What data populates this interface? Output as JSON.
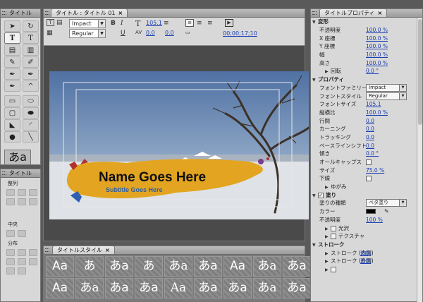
{
  "tools_panel": {
    "title": "タイトル"
  },
  "align_panel": {
    "title": "タイトル",
    "sections": [
      "整列",
      "中央",
      "分布"
    ]
  },
  "editor": {
    "tab_label": "タイトル : タイトル 01",
    "font_family": "Impact",
    "font_style": "Regular",
    "font_size": "105.1",
    "kerning": "0.0",
    "leading": "0.0",
    "timecode": "00;00;17;10",
    "canvas": {
      "title_text": "Name Goes Here",
      "subtitle_text": "Subtitle Goes Here"
    }
  },
  "styles_panel": {
    "title": "タイトルスタイル",
    "swatches": [
      "Aa",
      "あ",
      "あa",
      "あ",
      "あa",
      "あa",
      "Aa",
      "あa",
      "あa",
      "Aa",
      "あa",
      "あa",
      "あa",
      "Aa",
      "あa",
      "あa",
      "あa",
      "あa"
    ]
  },
  "properties": {
    "title": "タイトルプロパティ",
    "rows": [
      {
        "kind": "sec",
        "label": "変形",
        "open": true
      },
      {
        "label": "不透明度",
        "value": "100.0 %"
      },
      {
        "label": "X 座標",
        "value": "100.0 %"
      },
      {
        "label": "Y 座標",
        "value": "100.0 %"
      },
      {
        "label": "幅",
        "value": "100.0 %"
      },
      {
        "label": "高さ",
        "value": "100.0 %"
      },
      {
        "kind": "sub",
        "label": "回転",
        "value": "0.0 °",
        "tri": true
      },
      {
        "kind": "sec",
        "label": "プロパティ",
        "open": true
      },
      {
        "label": "フォントファミリー",
        "drop": "Impact"
      },
      {
        "label": "フォントスタイル",
        "drop": "Regular"
      },
      {
        "label": "フォントサイズ",
        "value": "105.1"
      },
      {
        "label": "縦横比",
        "value": "100.0 %"
      },
      {
        "label": "行間",
        "value": "0.0"
      },
      {
        "label": "カーニング",
        "value": "0.0"
      },
      {
        "label": "トラッキング",
        "value": "0.0"
      },
      {
        "label": "ベースラインシフト",
        "value": "0.0"
      },
      {
        "label": "傾き",
        "value": "0.0 °"
      },
      {
        "label": "オールキャップス",
        "check": true
      },
      {
        "label": "サイズ",
        "value": "75.0 %"
      },
      {
        "label": "下線",
        "check": true
      },
      {
        "kind": "sub",
        "label": "ゆがみ",
        "tri": true
      },
      {
        "kind": "sec",
        "label": "塗り",
        "open": true,
        "checked": true
      },
      {
        "label": "塗りの種類",
        "drop": "ベタ塗り"
      },
      {
        "label": "カラー",
        "color": "#000000"
      },
      {
        "label": "不透明度",
        "value": "100 %"
      },
      {
        "kind": "sub",
        "label": "光沢",
        "tri": true,
        "check": true
      },
      {
        "kind": "sub",
        "label": "テクスチャ",
        "tri": true,
        "check": true
      },
      {
        "kind": "sec",
        "label": "ストローク",
        "open": true
      },
      {
        "kind": "sub",
        "label": "ストローク (内側)",
        "tri": true,
        "link": "追加"
      },
      {
        "kind": "sub",
        "label": "ストローク (外側)",
        "tri": true,
        "link": "追加"
      },
      {
        "kind": "sub",
        "label": "",
        "tri": true,
        "check": true
      }
    ]
  }
}
